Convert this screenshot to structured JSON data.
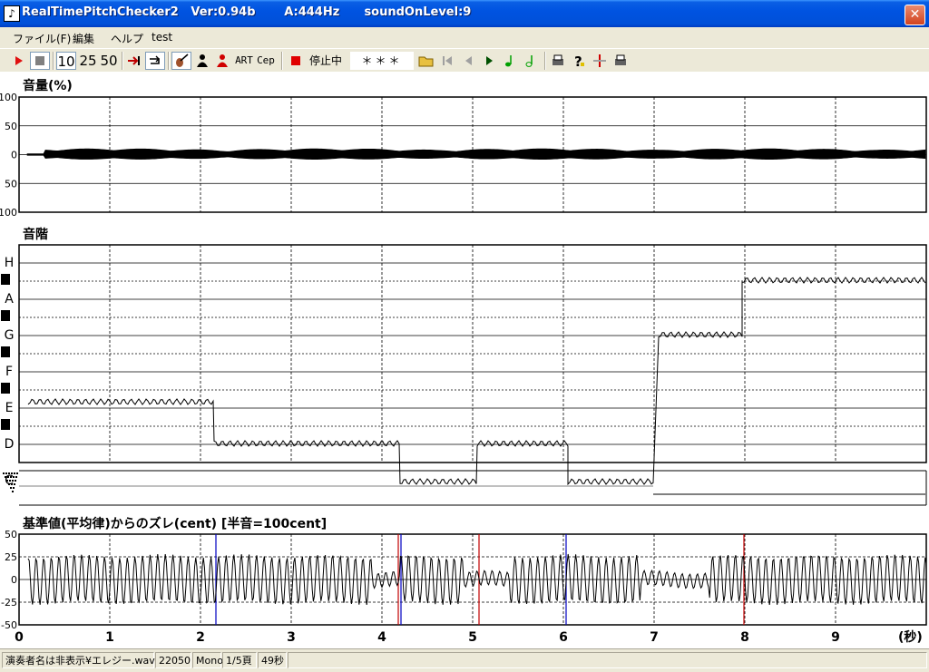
{
  "window": {
    "title": "RealTimePitchChecker2   Ver:0.94b       A:444Hz      soundOnLevel:9",
    "close_glyph": "✕"
  },
  "menu": [
    "ファイル(F)",
    "編集",
    "ヘルプ",
    "test"
  ],
  "toolbar": {
    "play_icon": "play-icon",
    "stop_icon": "stop-icon",
    "speed_10": "10",
    "speed_25": "25",
    "speed_50": "50",
    "art_label": "ART",
    "cep_label": "Cep",
    "status_text": "停止中",
    "note_display": "＊＊＊"
  },
  "panels": {
    "volume_title": "音量(%)",
    "volume_ticks": [
      "100",
      "50",
      "0",
      "50",
      "100"
    ],
    "scale_title": "音階",
    "notes": [
      "H",
      "A",
      "G",
      "F",
      "E",
      "D",
      "C"
    ],
    "cent_title": "基準値(平均律)からのズレ(cent) [半音=100cent]",
    "cent_ticks": [
      "50",
      "25",
      "0",
      "-25",
      "-50"
    ],
    "time_ticks": [
      "0",
      "1",
      "2",
      "3",
      "4",
      "5",
      "6",
      "7",
      "8",
      "9"
    ],
    "time_unit": "(秒)"
  },
  "pitch_segments": [
    {
      "t0": 0.1,
      "t1": 2.15,
      "note": "E",
      "offset": 0.15
    },
    {
      "t0": 2.15,
      "t1": 4.2,
      "note": "D",
      "offset": 0.0
    },
    {
      "t0": 4.2,
      "t1": 5.05,
      "note": "C",
      "offset": -0.05
    },
    {
      "t0": 5.05,
      "t1": 6.05,
      "note": "D",
      "offset": 0.0
    },
    {
      "t0": 6.05,
      "t1": 7.0,
      "note": "C",
      "offset": -0.05
    },
    {
      "t0": 7.05,
      "t1": 7.97,
      "note": "G",
      "offset": 0.0
    },
    {
      "t0": 7.97,
      "t1": 10.0,
      "note": "A",
      "offset": 0.5
    }
  ],
  "status": {
    "file": "演奏者名は非表示¥エレジー.wav",
    "rate": "22050",
    "channels": "Mono",
    "page": "1/5頁",
    "duration": "49秒"
  }
}
